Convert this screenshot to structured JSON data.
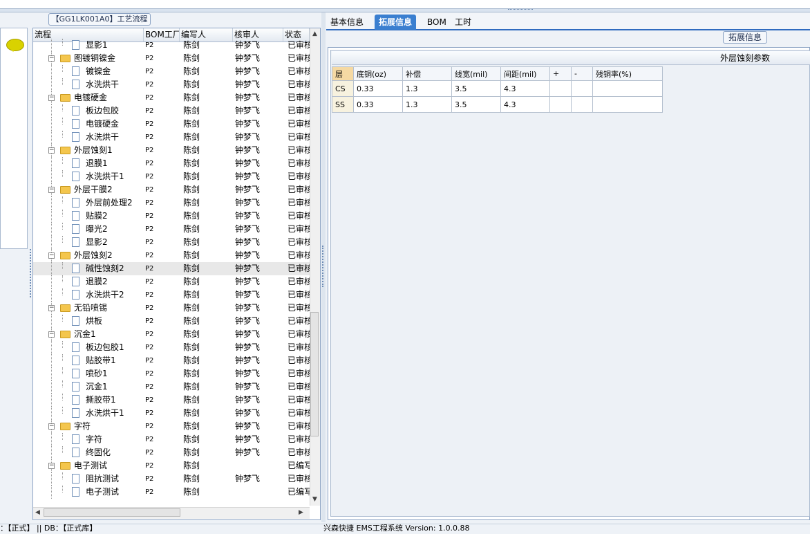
{
  "left_panel": {
    "title": "【GG1LK001A0】工艺流程"
  },
  "tree": {
    "columns": [
      "流程",
      "BOM工厂",
      "编写人",
      "核审人",
      "状态"
    ],
    "rows": [
      {
        "level": 2,
        "name": "显影1",
        "bom": "P2",
        "writer": "陈剑",
        "reviewer": "钟梦飞",
        "status": "已审核"
      },
      {
        "level": 1,
        "name": "图镀铜镍金",
        "bom": "P2",
        "writer": "陈剑",
        "reviewer": "钟梦飞",
        "status": "已审核"
      },
      {
        "level": 2,
        "name": "镀镍金",
        "bom": "P2",
        "writer": "陈剑",
        "reviewer": "钟梦飞",
        "status": "已审核"
      },
      {
        "level": 2,
        "name": "水洗烘干",
        "bom": "P2",
        "writer": "陈剑",
        "reviewer": "钟梦飞",
        "status": "已审核"
      },
      {
        "level": 1,
        "name": "电镀硬金",
        "bom": "P2",
        "writer": "陈剑",
        "reviewer": "钟梦飞",
        "status": "已审核"
      },
      {
        "level": 2,
        "name": "板边包胶",
        "bom": "P2",
        "writer": "陈剑",
        "reviewer": "钟梦飞",
        "status": "已审核"
      },
      {
        "level": 2,
        "name": "电镀硬金",
        "bom": "P2",
        "writer": "陈剑",
        "reviewer": "钟梦飞",
        "status": "已审核"
      },
      {
        "level": 2,
        "name": "水洗烘干",
        "bom": "P2",
        "writer": "陈剑",
        "reviewer": "钟梦飞",
        "status": "已审核"
      },
      {
        "level": 1,
        "name": "外层蚀刻1",
        "bom": "P2",
        "writer": "陈剑",
        "reviewer": "钟梦飞",
        "status": "已审核"
      },
      {
        "level": 2,
        "name": "退膜1",
        "bom": "P2",
        "writer": "陈剑",
        "reviewer": "钟梦飞",
        "status": "已审核"
      },
      {
        "level": 2,
        "name": "水洗烘干1",
        "bom": "P2",
        "writer": "陈剑",
        "reviewer": "钟梦飞",
        "status": "已审核"
      },
      {
        "level": 1,
        "name": "外层干膜2",
        "bom": "P2",
        "writer": "陈剑",
        "reviewer": "钟梦飞",
        "status": "已审核"
      },
      {
        "level": 2,
        "name": "外层前处理2",
        "bom": "P2",
        "writer": "陈剑",
        "reviewer": "钟梦飞",
        "status": "已审核"
      },
      {
        "level": 2,
        "name": "贴膜2",
        "bom": "P2",
        "writer": "陈剑",
        "reviewer": "钟梦飞",
        "status": "已审核"
      },
      {
        "level": 2,
        "name": "曝光2",
        "bom": "P2",
        "writer": "陈剑",
        "reviewer": "钟梦飞",
        "status": "已审核"
      },
      {
        "level": 2,
        "name": "显影2",
        "bom": "P2",
        "writer": "陈剑",
        "reviewer": "钟梦飞",
        "status": "已审核"
      },
      {
        "level": 1,
        "name": "外层蚀刻2",
        "bom": "P2",
        "writer": "陈剑",
        "reviewer": "钟梦飞",
        "status": "已审核"
      },
      {
        "level": 2,
        "name": "碱性蚀刻2",
        "bom": "P2",
        "writer": "陈剑",
        "reviewer": "钟梦飞",
        "status": "已审核",
        "selected": true
      },
      {
        "level": 2,
        "name": "退膜2",
        "bom": "P2",
        "writer": "陈剑",
        "reviewer": "钟梦飞",
        "status": "已审核"
      },
      {
        "level": 2,
        "name": "水洗烘干2",
        "bom": "P2",
        "writer": "陈剑",
        "reviewer": "钟梦飞",
        "status": "已审核"
      },
      {
        "level": 1,
        "name": "无铅喷锡",
        "bom": "P2",
        "writer": "陈剑",
        "reviewer": "钟梦飞",
        "status": "已审核"
      },
      {
        "level": 2,
        "name": "烘板",
        "bom": "P2",
        "writer": "陈剑",
        "reviewer": "钟梦飞",
        "status": "已审核"
      },
      {
        "level": 1,
        "name": "沉金1",
        "bom": "P2",
        "writer": "陈剑",
        "reviewer": "钟梦飞",
        "status": "已审核"
      },
      {
        "level": 2,
        "name": "板边包胶1",
        "bom": "P2",
        "writer": "陈剑",
        "reviewer": "钟梦飞",
        "status": "已审核"
      },
      {
        "level": 2,
        "name": "贴胶带1",
        "bom": "P2",
        "writer": "陈剑",
        "reviewer": "钟梦飞",
        "status": "已审核"
      },
      {
        "level": 2,
        "name": "喷砂1",
        "bom": "P2",
        "writer": "陈剑",
        "reviewer": "钟梦飞",
        "status": "已审核"
      },
      {
        "level": 2,
        "name": "沉金1",
        "bom": "P2",
        "writer": "陈剑",
        "reviewer": "钟梦飞",
        "status": "已审核"
      },
      {
        "level": 2,
        "name": "撕胶带1",
        "bom": "P2",
        "writer": "陈剑",
        "reviewer": "钟梦飞",
        "status": "已审核"
      },
      {
        "level": 2,
        "name": "水洗烘干1",
        "bom": "P2",
        "writer": "陈剑",
        "reviewer": "钟梦飞",
        "status": "已审核"
      },
      {
        "level": 1,
        "name": "字符",
        "bom": "P2",
        "writer": "陈剑",
        "reviewer": "钟梦飞",
        "status": "已审核"
      },
      {
        "level": 2,
        "name": "字符",
        "bom": "P2",
        "writer": "陈剑",
        "reviewer": "钟梦飞",
        "status": "已审核"
      },
      {
        "level": 2,
        "name": "终固化",
        "bom": "P2",
        "writer": "陈剑",
        "reviewer": "钟梦飞",
        "status": "已审核"
      },
      {
        "level": 1,
        "name": "电子测试",
        "bom": "P2",
        "writer": "陈剑",
        "reviewer": "",
        "status": "已编写"
      },
      {
        "level": 2,
        "name": "阻抗测试",
        "bom": "P2",
        "writer": "陈剑",
        "reviewer": "钟梦飞",
        "status": "已审核"
      },
      {
        "level": 2,
        "name": "电子测试",
        "bom": "P2",
        "writer": "陈剑",
        "reviewer": "",
        "status": "已编写"
      }
    ]
  },
  "tabs": [
    "基本信息",
    "拓展信息",
    "BOM",
    "工时"
  ],
  "active_tab": "拓展信息",
  "ext": {
    "badge": "拓展信息",
    "grid_title": "外层蚀刻参数",
    "columns": [
      "层",
      "底铜(oz)",
      "补偿",
      "线宽(mil)",
      "间距(mil)",
      "+",
      "-",
      "残铜率(%)"
    ],
    "rows": [
      [
        "CS",
        "0.33",
        "1.3",
        "3.5",
        "4.3",
        "",
        "",
        ""
      ],
      [
        "SS",
        "0.33",
        "1.3",
        "3.5",
        "4.3",
        "",
        "",
        ""
      ]
    ]
  },
  "status": {
    "left": "：【正式】 || DB：【正式库】",
    "right": "兴森快捷 EMS工程系统 Version: 1.0.0.88"
  },
  "colors": {
    "tab_active": "#3a7fd0",
    "folder": "#f4c64d",
    "layer_header": "#f5d9a3"
  }
}
